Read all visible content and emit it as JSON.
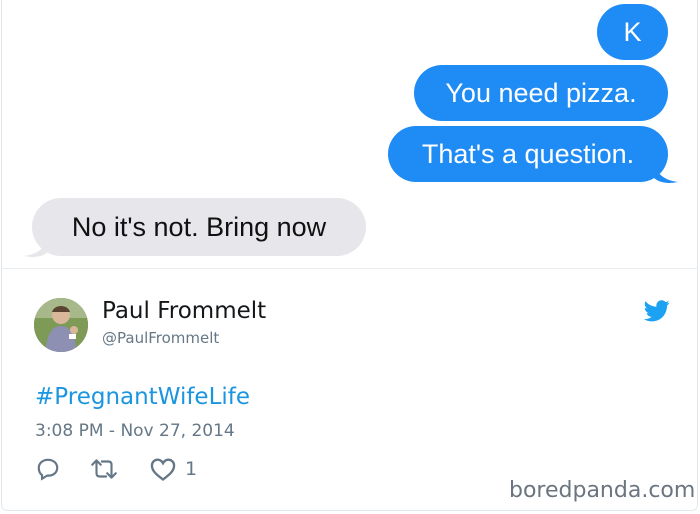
{
  "chat": {
    "messages": [
      {
        "direction": "outgoing",
        "text": "K"
      },
      {
        "direction": "outgoing",
        "text": "You need pizza."
      },
      {
        "direction": "outgoing",
        "text": "That's a question."
      },
      {
        "direction": "incoming",
        "text": "No it's not.  Bring now"
      }
    ]
  },
  "tweet": {
    "author_name": "Paul Frommelt",
    "author_handle": "@PaulFrommelt",
    "hashtag": "#PregnantWifeLife",
    "timestamp": "3:08 PM - Nov 27, 2014",
    "like_count": "1"
  },
  "watermark": "boredpanda.com",
  "colors": {
    "outgoing_bubble": "#1f8cf5",
    "incoming_bubble": "#e6e6eb",
    "link_blue": "#1b95e0",
    "meta_gray": "#657786"
  },
  "icons": [
    "twitter-bird-icon",
    "reply-icon",
    "retweet-icon",
    "heart-icon"
  ]
}
